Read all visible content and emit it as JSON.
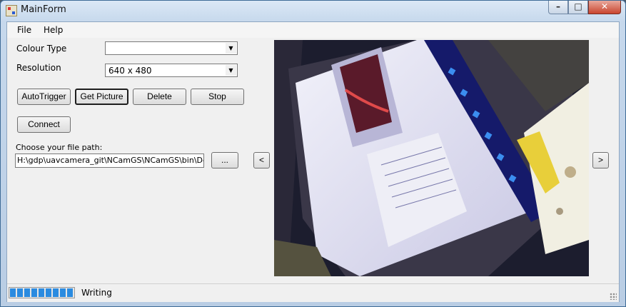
{
  "window": {
    "title": "MainForm",
    "caption_buttons": {
      "minimize": "–",
      "maximize": "□",
      "close": "✕"
    }
  },
  "menu": [
    {
      "label": "File"
    },
    {
      "label": "Help"
    }
  ],
  "form": {
    "colour_type_label": "Colour Type",
    "colour_type_value": "",
    "resolution_label": "Resolution",
    "resolution_value": "640 x 480",
    "buttons": {
      "autotrigger": "AutoTrigger",
      "get_picture": "Get Picture",
      "delete": "Delete",
      "stop": "Stop",
      "connect": "Connect",
      "browse": "...",
      "prev": "<",
      "next": ">"
    },
    "file_path_label": "Choose your file path:",
    "file_path_value": "H:\\gdp\\uavcamera_git\\NCamGS\\NCamGS\\bin\\Debug"
  },
  "status": {
    "text": "Writing",
    "progress": 1.0
  },
  "icons": {
    "dropdown_arrow": "▼",
    "app_icon": "app-icon"
  },
  "colors": {
    "progress": "#2a8be0",
    "title_bar": "#c6d8ec"
  }
}
